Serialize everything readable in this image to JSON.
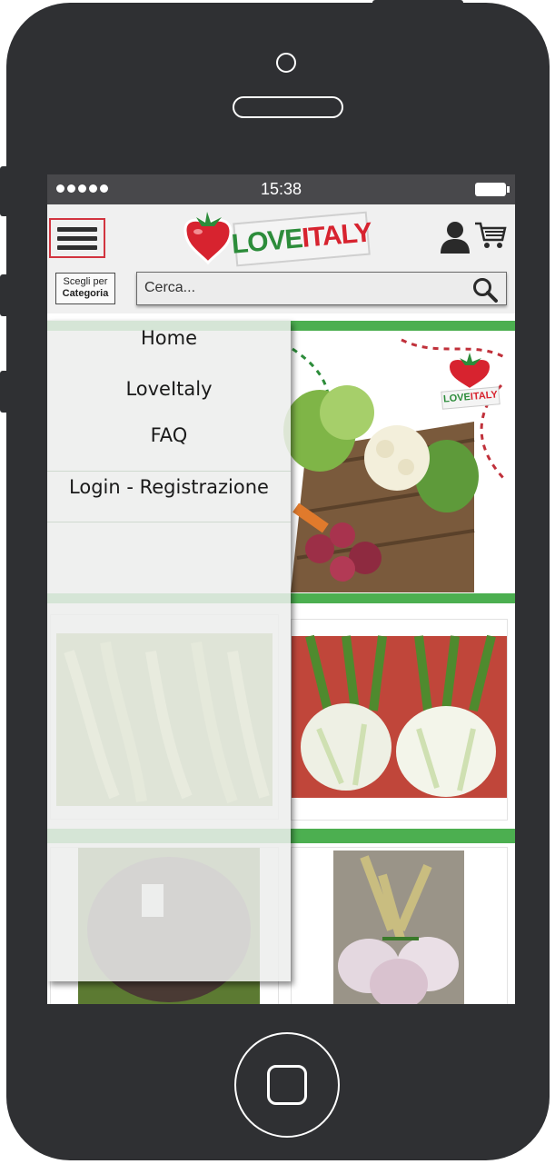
{
  "status_bar": {
    "time": "15:38",
    "signal_dots": 5
  },
  "header": {
    "menu_icon": "hamburger-icon",
    "logo": {
      "part1": "LOVE",
      "part2": "ITALY"
    },
    "user_icon": "user-icon",
    "cart_icon": "cart-icon",
    "category_button": {
      "line1": "Scegli per",
      "line2": "Categoria"
    },
    "search": {
      "placeholder": "Cerca...",
      "icon": "search-icon"
    }
  },
  "menu": {
    "items": [
      {
        "label": "Home"
      },
      {
        "label": "LoveItaly"
      },
      {
        "label": "FAQ"
      },
      {
        "label": "Login - Registrazione"
      }
    ]
  },
  "banner": {
    "logo": {
      "part1": "LOVE",
      "part2": "ITALY"
    }
  },
  "colors": {
    "accent_green": "#4caf50",
    "brand_red": "#d7232f",
    "brand_green": "#2c8c3a",
    "phone_body": "#2f3033"
  }
}
